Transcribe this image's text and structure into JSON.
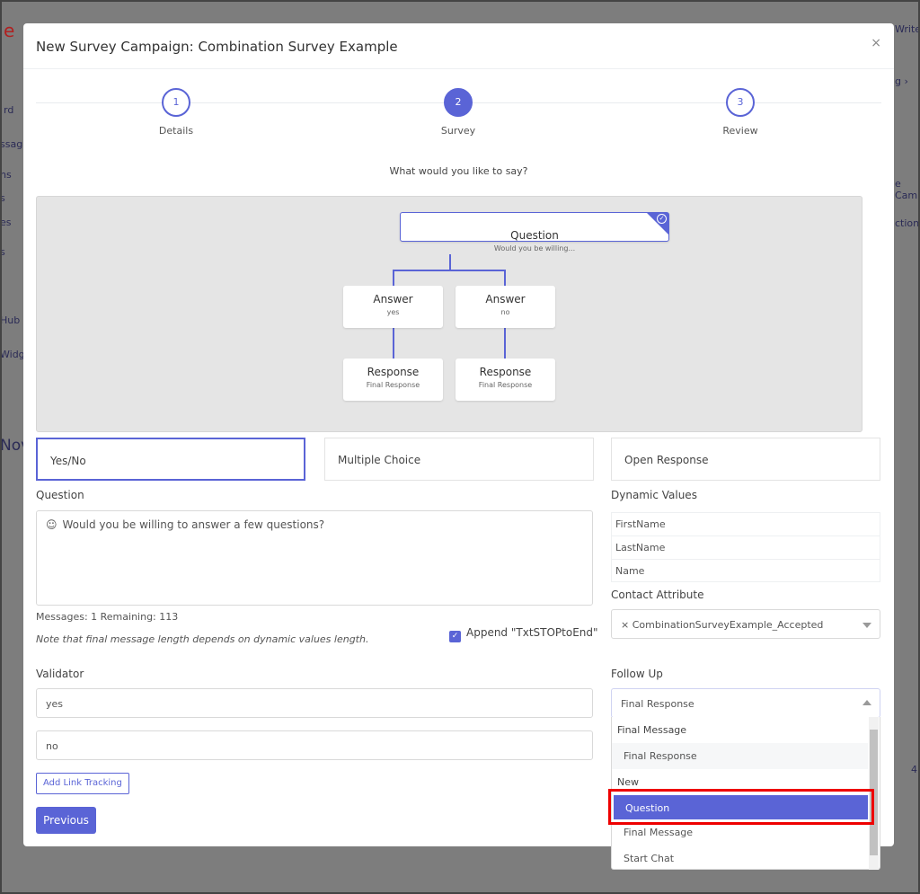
{
  "background": {
    "logo": "e",
    "nav": [
      "rd",
      "ssag",
      "ns",
      "s",
      "es",
      "s",
      "Hub",
      "Widg"
    ],
    "heading": "Nov",
    "right": [
      "Write",
      "g ›",
      "e Cam",
      "ction",
      "4"
    ]
  },
  "modal": {
    "title": "New Survey Campaign: Combination Survey Example",
    "close": "×",
    "steps": [
      {
        "num": "1",
        "label": "Details"
      },
      {
        "num": "2",
        "label": "Survey",
        "active": true
      },
      {
        "num": "3",
        "label": "Review"
      }
    ],
    "prompt": "What would you like to say?",
    "flow": {
      "question": {
        "title": "Question",
        "subtitle": "Would you be willing..."
      },
      "answers": [
        {
          "title": "Answer",
          "subtitle": "yes"
        },
        {
          "title": "Answer",
          "subtitle": "no"
        }
      ],
      "responses": [
        {
          "title": "Response",
          "subtitle": "Final Response"
        },
        {
          "title": "Response",
          "subtitle": "Final Response"
        }
      ]
    },
    "types": [
      {
        "label": "Yes/No",
        "active": true
      },
      {
        "label": "Multiple Choice"
      },
      {
        "label": "Open Response"
      }
    ],
    "question_label": "Question",
    "question_text": "Would you be willing to answer a few questions?",
    "counts": "Messages: 1 Remaining: 113",
    "note": "Note that final message length depends on dynamic values length.",
    "append_label": "Append \"TxtSTOPtoEnd\"",
    "append_checked": true,
    "validator_label": "Validator",
    "validators": [
      "yes",
      "no"
    ],
    "add_link_tracking": "Add Link Tracking",
    "previous": "Previous",
    "dynamic_values_label": "Dynamic Values",
    "dynamic_values": [
      "FirstName",
      "LastName",
      "Name"
    ],
    "contact_attribute_label": "Contact Attribute",
    "contact_attribute_value": "× CombinationSurveyExample_Accepted",
    "follow_up_label": "Follow Up",
    "follow_up_value": "Final Response",
    "follow_up_options": [
      {
        "label": "Final Message",
        "type": "group"
      },
      {
        "label": "Final Response",
        "type": "option",
        "hover": true
      },
      {
        "label": "New",
        "type": "group"
      },
      {
        "label": "Question",
        "type": "option",
        "selected": true
      },
      {
        "label": "Final Message",
        "type": "option"
      },
      {
        "label": "Start Chat",
        "type": "option"
      }
    ]
  },
  "colors": {
    "accent": "#5a64d6",
    "highlight_box": "#e00000"
  }
}
